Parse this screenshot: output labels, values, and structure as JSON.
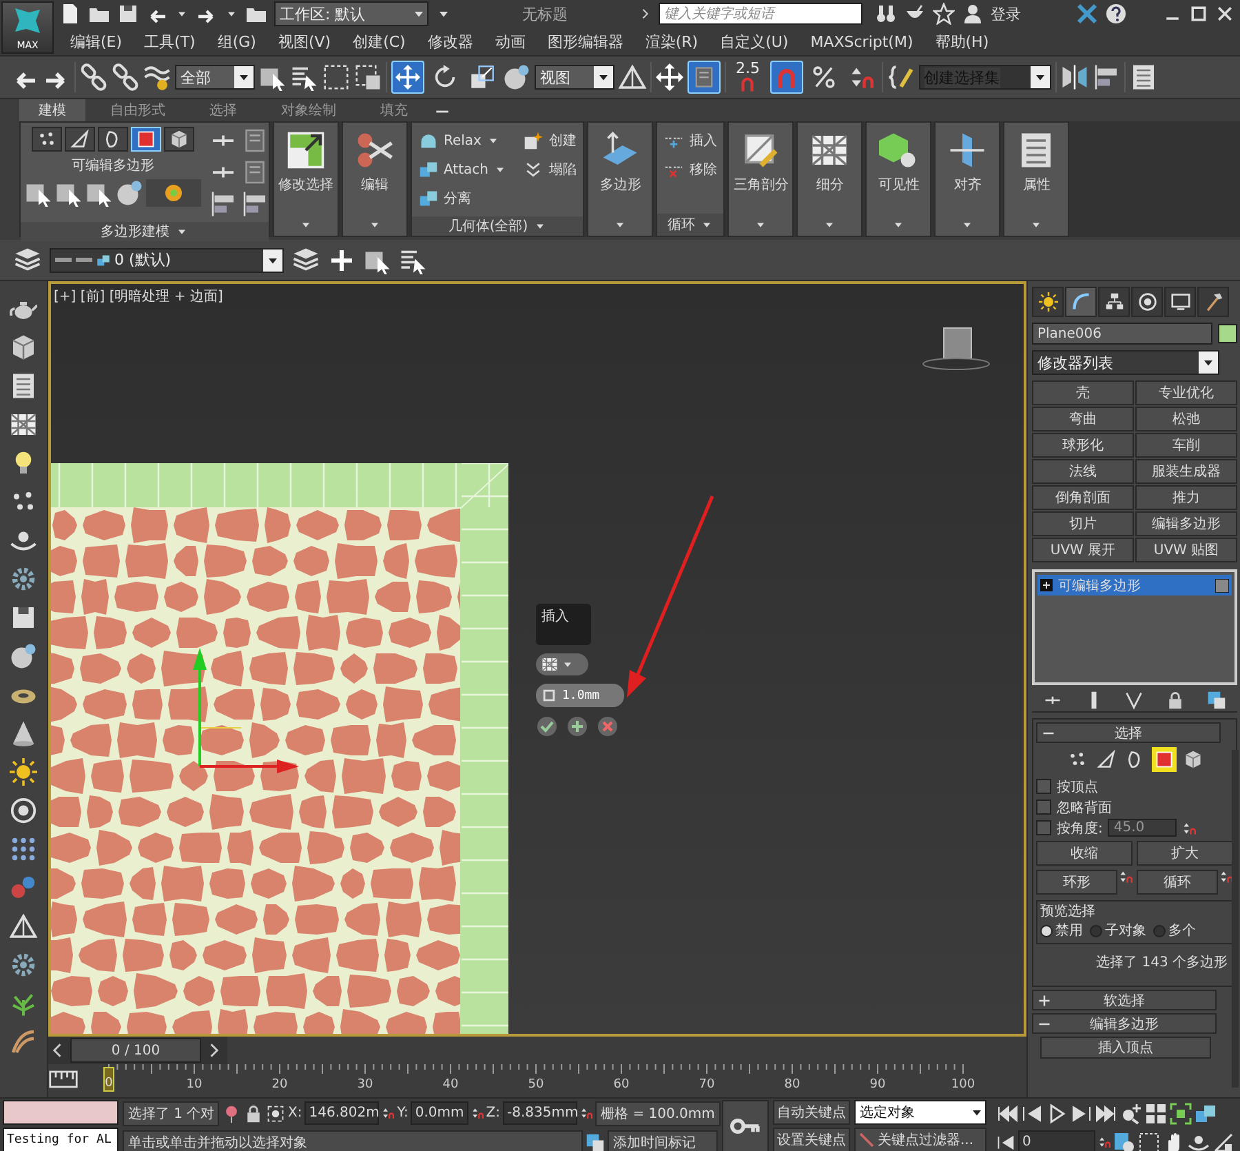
{
  "title_bar": {
    "logo": "MAX",
    "workspace": "工作区: 默认",
    "title": "无标题",
    "search": {
      "placeholder": "键入关键字或短语"
    },
    "login": "登录"
  },
  "menu": [
    "编辑(E)",
    "工具(T)",
    "组(G)",
    "视图(V)",
    "创建(C)",
    "修改器",
    "动画",
    "图形编辑器",
    "渲染(R)",
    "自定义(U)",
    "MAXScript(M)",
    "帮助(H)"
  ],
  "main_toolbar": {
    "selection_filter": "全部",
    "reference_coordinate": "视图",
    "snap_value": "2.5",
    "selection_set": "创建选择集",
    "toggles": [
      {
        "selected": true
      },
      {
        "selected": false
      },
      {
        "selected": false
      },
      {
        "selected": true
      },
      {
        "selected": false
      },
      {
        "selected": true
      },
      {
        "selected": false
      },
      {
        "selected": false
      }
    ]
  },
  "ribbon": {
    "tabs": [
      {
        "label": "建模",
        "selected": true
      },
      {
        "label": "自由形式",
        "selected": false
      },
      {
        "label": "选择",
        "selected": false
      },
      {
        "label": "对象绘制",
        "selected": false
      },
      {
        "label": "填充",
        "selected": false
      }
    ],
    "panels": [
      {
        "kind": "modes",
        "label": "可编辑多边形",
        "footer": "多边形建模",
        "modes": [
          {
            "selected": false
          },
          {
            "selected": false
          },
          {
            "selected": false
          },
          {
            "selected": true
          },
          {
            "selected": false
          }
        ]
      },
      {
        "kind": "big",
        "label": "修改选择"
      },
      {
        "kind": "big",
        "label": "编辑"
      },
      {
        "kind": "list",
        "footer": "几何体(全部)",
        "columns": [
          [
            {
              "label": "Relax",
              "dropdown": true
            },
            {
              "label": "Attach",
              "dropdown": true
            },
            {
              "label": "分离",
              "dropdown": false
            }
          ],
          [
            {
              "label": "创建",
              "dropdown": false
            },
            {
              "label": "塌陷",
              "dropdown": false
            }
          ]
        ]
      },
      {
        "kind": "big",
        "label": "多边形"
      },
      {
        "kind": "list",
        "footer": "循环",
        "columns": [
          [
            {
              "label": "插入",
              "dropdown": false
            },
            {
              "label": "移除",
              "dropdown": false
            }
          ]
        ]
      },
      {
        "kind": "big",
        "label": "三角剖分"
      },
      {
        "kind": "big",
        "label": "细分"
      },
      {
        "kind": "big",
        "label": "可见性"
      },
      {
        "kind": "big",
        "label": "对齐"
      },
      {
        "kind": "big",
        "label": "属性"
      }
    ]
  },
  "layer_bar": {
    "layer": "0 (默认)"
  },
  "viewport": {
    "label": "[+] [前] [明暗处理 + 边面]",
    "active": true,
    "caddy": {
      "title": "插入",
      "value": "1.0mm"
    }
  },
  "time_slider": {
    "position": "0 / 100",
    "frame_marker": "0",
    "ticks": [
      "10",
      "20",
      "30",
      "40",
      "50",
      "60",
      "70",
      "80",
      "90",
      "100"
    ]
  },
  "command_panel": {
    "tabs": [
      {
        "selected": false
      },
      {
        "selected": true
      },
      {
        "selected": false
      },
      {
        "selected": false
      },
      {
        "selected": false
      },
      {
        "selected": false
      }
    ],
    "object": {
      "name": "Plane006",
      "color": "#a6d98a"
    },
    "modifier_list": "修改器列表",
    "modifier_buttons": [
      "壳",
      "专业优化",
      "弯曲",
      "松弛",
      "球形化",
      "车削",
      "法线",
      "服装生成器",
      "倒角剖面",
      "推力",
      "切片",
      "编辑多边形",
      "UVW 展开",
      "UVW 贴图"
    ],
    "stack": [
      {
        "label": "可编辑多边形",
        "selected": true
      }
    ],
    "rollouts": [
      {
        "kind": "selection",
        "title": "选择",
        "expanded": true,
        "levels": [
          {
            "selected": false
          },
          {
            "selected": false
          },
          {
            "selected": false
          },
          {
            "selected": true
          },
          {
            "selected": false
          }
        ],
        "checkboxes": [
          {
            "label": "按顶点",
            "checked": false
          },
          {
            "label": "忽略背面",
            "checked": false
          },
          {
            "label": "按角度:",
            "checked": false
          }
        ],
        "angle": "45.0",
        "buttons": [
          "收缩",
          "扩大"
        ],
        "spinner_buttons": [
          "环形",
          "循环"
        ],
        "preview": {
          "title": "预览选择",
          "options": [
            {
              "label": "禁用",
              "selected": true
            },
            {
              "label": "子对象",
              "selected": false
            },
            {
              "label": "多个",
              "selected": false
            }
          ]
        },
        "status": "选择了 143 个多边形"
      },
      {
        "kind": "header",
        "title": "软选择",
        "expanded": false
      },
      {
        "kind": "header",
        "title": "编辑多边形",
        "expanded": true,
        "buttons": [
          "插入顶点"
        ]
      }
    ]
  },
  "status_bar": {
    "listener_output": "Testing for AL",
    "selection_info": "选择了 1 个对",
    "coordinates": [
      {
        "axis": "X:",
        "value": "146.802m"
      },
      {
        "axis": "Y:",
        "value": "0.0mm"
      },
      {
        "axis": "Z:",
        "value": "-8.835mm"
      }
    ],
    "grid": "栅格 = 100.0mm",
    "prompt": "单击或单击并拖动以选择对象",
    "time_tag": "添加时间标记",
    "auto_key": "自动关键点",
    "set_key": "设置关键点",
    "key_mode": "选定对象",
    "key_filters": "关键点过滤器...",
    "frame": "0"
  }
}
